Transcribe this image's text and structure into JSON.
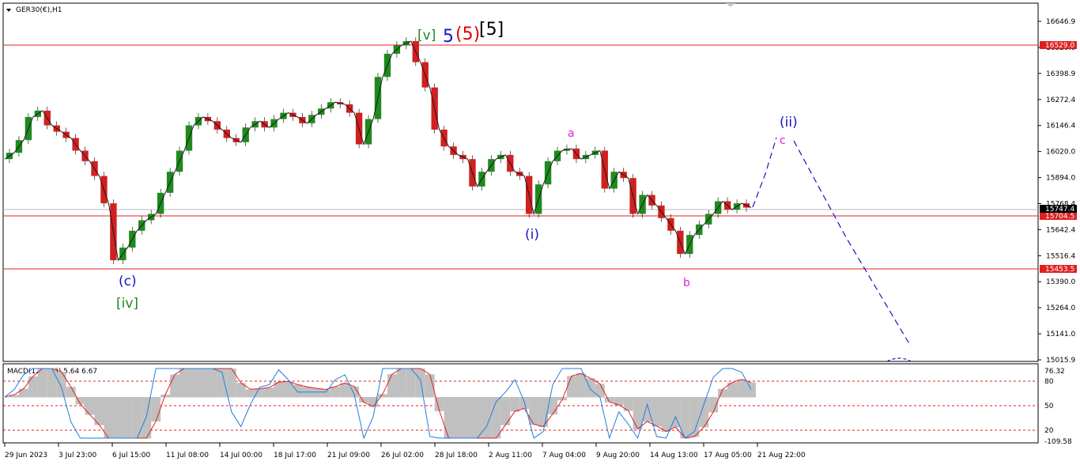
{
  "header": {
    "symbol_label": "GER30(€),H1"
  },
  "macd": {
    "label": "MACD(12,26,9) 5.64 6.67"
  },
  "price_axis": {
    "ticks": [
      "16646.9",
      "16520.0",
      "16398.9",
      "16272.4",
      "16146.4",
      "16020.0",
      "15894.0",
      "15768.4",
      "15642.4",
      "15516.4",
      "15390.0",
      "15264.0",
      "15141.0",
      "15015.9"
    ],
    "current_label": "15747.4"
  },
  "macd_axis": {
    "ticks": [
      "76.32",
      "80",
      "50",
      "20",
      "-109.58"
    ]
  },
  "time_axis": {
    "ticks": [
      "29 Jun 2023",
      "3 Jul 23:00",
      "6 Jul 15:00",
      "11 Jul 08:00",
      "14 Jul 00:00",
      "18 Jul 17:00",
      "21 Jul 09:00",
      "26 Jul 02:00",
      "28 Jul 18:00",
      "2 Aug 11:00",
      "7 Aug 04:00",
      "9 Aug 20:00",
      "14 Aug 13:00",
      "17 Aug 05:00",
      "21 Aug 22:00"
    ]
  },
  "levels": [
    {
      "label": "16529.0",
      "value": 16529.0
    },
    {
      "label": "15704.5",
      "value": 15704.5
    },
    {
      "label": "15453.5",
      "value": 15453.5
    }
  ],
  "wave_labels": {
    "top_v": "[v]",
    "top_5": "5",
    "top_5p": "(5)",
    "top_5b": "[5]",
    "c": "(c)",
    "iv": "[iv]",
    "i": "(i)",
    "a": "a",
    "b": "b",
    "ii": "(ii)",
    "cc": "c"
  },
  "colors": {
    "green": "#1f8a1f",
    "blue": "#1515c8",
    "red": "#e00000",
    "magenta": "#e020e0",
    "level": "#e02020",
    "macd_line": "#1e7fe0",
    "signal": "#e02020"
  },
  "chart_data": {
    "type": "line",
    "title": "GER30(€),H1",
    "ylim": [
      15000,
      16700
    ],
    "x_ticks": [
      "29 Jun 2023",
      "3 Jul 23:00",
      "6 Jul 15:00",
      "11 Jul 08:00",
      "14 Jul 00:00",
      "18 Jul 17:00",
      "21 Jul 09:00",
      "26 Jul 02:00",
      "28 Jul 18:00",
      "2 Aug 11:00",
      "7 Aug 04:00",
      "9 Aug 20:00",
      "14 Aug 13:00",
      "17 Aug 05:00",
      "21 Aug 22:00"
    ],
    "series": [
      {
        "values": [
          15960,
          15990,
          16050,
          16160,
          16190,
          16120,
          16090,
          16060,
          16000,
          15950,
          15880,
          15750,
          15480,
          15540,
          15620,
          15670,
          15700,
          15800,
          15900,
          16000,
          16120,
          16160,
          16140,
          16100,
          16060,
          16040,
          16110,
          16140,
          16110,
          16150,
          16180,
          16160,
          16130,
          16170,
          16200,
          16230,
          16220,
          16180,
          16030,
          16150,
          16350,
          16460,
          16500,
          16520,
          16420,
          16300,
          16100,
          16020,
          15980,
          15960,
          15830,
          15900,
          15960,
          15980,
          15900,
          15880,
          15700,
          15840,
          15950,
          16000,
          16010,
          15960,
          15980,
          16000,
          15820,
          15900,
          15870,
          15700,
          15790,
          15740,
          15680,
          15620,
          15510,
          15600,
          15650,
          15700,
          15760,
          15720,
          15750,
          15730
        ]
      },
      {
        "name": "",
        "values": [
          15747,
          15860,
          15980,
          16060
        ]
      },
      {
        "name": "",
        "values": [
          16060,
          15800,
          15500,
          15100
        ]
      }
    ],
    "macd": {
      "ylim": [
        -109.58,
        76.32
      ],
      "label": "MACD(12,26,9) 5.64 6.67"
    }
  }
}
